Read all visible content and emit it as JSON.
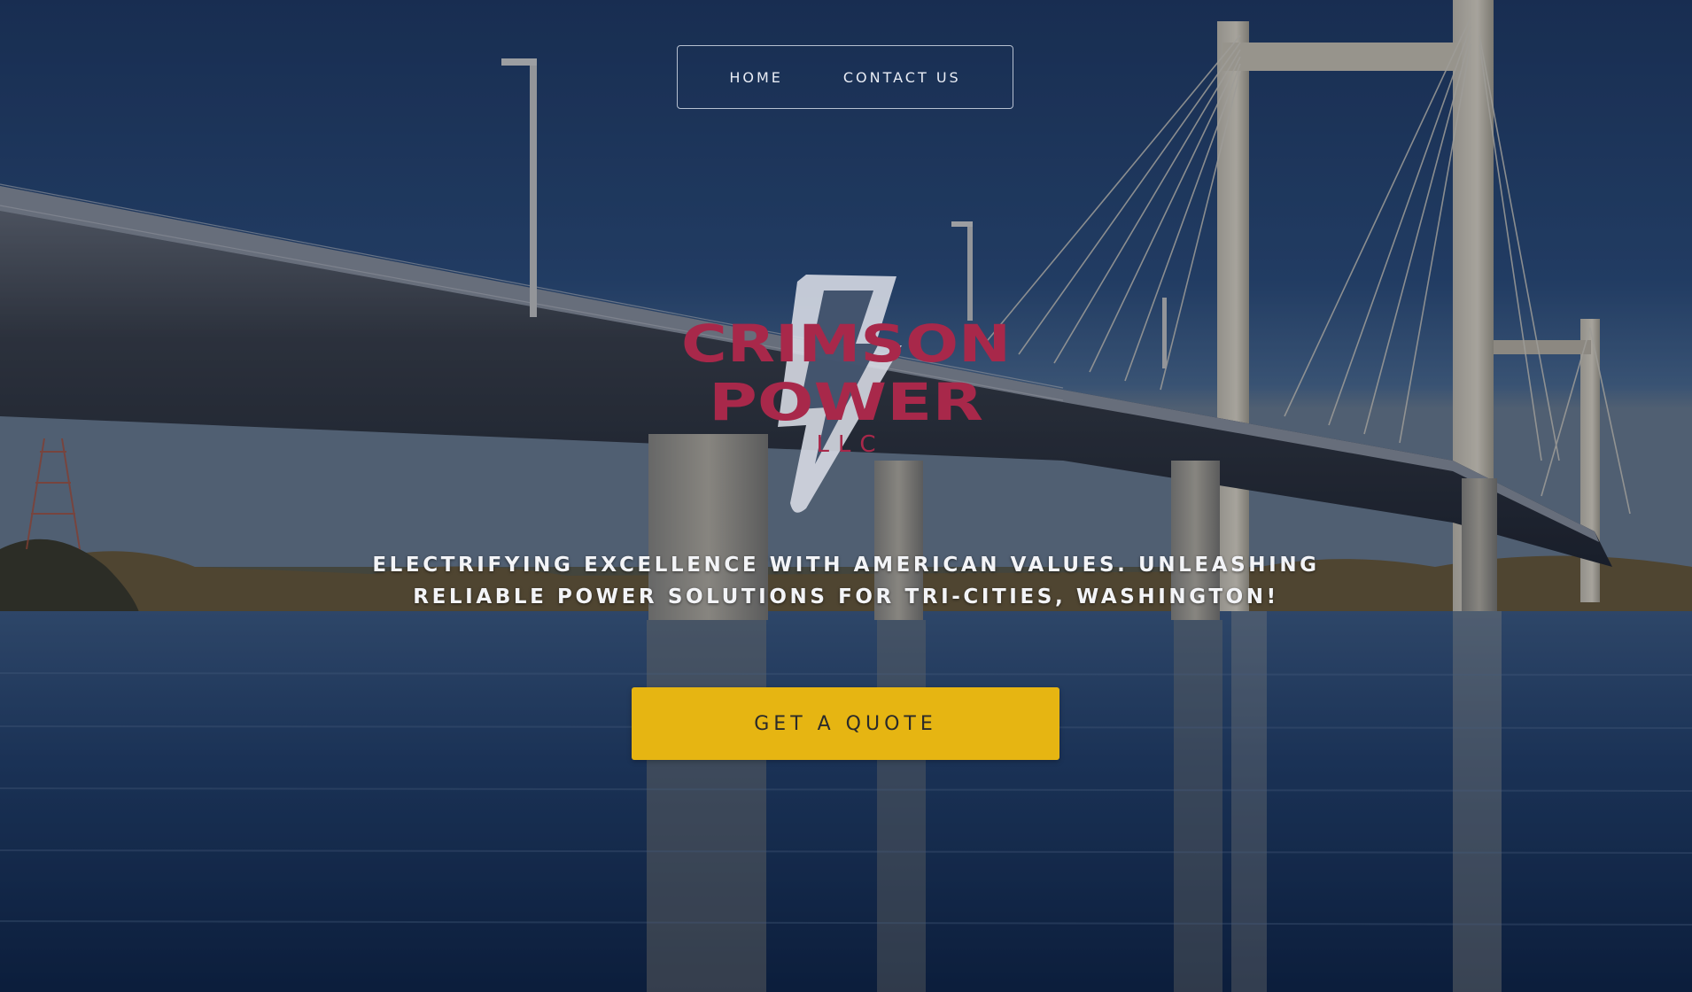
{
  "nav": {
    "items": [
      {
        "label": "HOME"
      },
      {
        "label": "CONTACT US"
      }
    ]
  },
  "logo": {
    "line1": "CRIMSON",
    "line2": "POWER",
    "line3": "LLC",
    "brand_color": "#a8284a",
    "bolt_color": "#d9dde6"
  },
  "hero": {
    "tagline_line1": "ELECTRIFYING EXCELLENCE WITH AMERICAN VALUES. UNLEASHING",
    "tagline_line2": "RELIABLE POWER SOLUTIONS FOR TRI-CITIES, WASHINGTON!",
    "cta_label": "GET A QUOTE",
    "cta_color": "#e6b512"
  }
}
